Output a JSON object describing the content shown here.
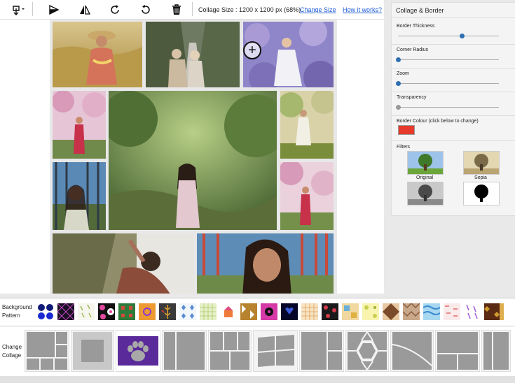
{
  "toolbar": {
    "icons": [
      "download-icon",
      "flip-horizontal-icon",
      "flip-vertical-icon",
      "rotate-right-icon",
      "rotate-left-icon",
      "trash-icon"
    ],
    "collage_size_text": "Collage Size : 1200 x 1200 px (68%)",
    "change_size_label": "Change Size",
    "how_it_works_label": "How it works?"
  },
  "panel": {
    "title": "Collage & Border",
    "sliders": [
      {
        "label": "Border Thickness",
        "value": 0.63
      },
      {
        "label": "Corner Radius",
        "value": 0.0
      },
      {
        "label": "Zoom",
        "value": 0.0
      },
      {
        "label": "Transparency",
        "value": 0.0
      }
    ],
    "border_colour_label": "Border Colour (click below to change)",
    "border_colour": "#e53a2c",
    "filters_label": "Filters",
    "filters": [
      {
        "label": "Original"
      },
      {
        "label": "Sepia"
      },
      {
        "label": ""
      },
      {
        "label": ""
      }
    ]
  },
  "background_pattern": {
    "label": "Background Pattern",
    "pattern_count": 22
  },
  "change_collage": {
    "label": "Change Collage",
    "layout_count": 11
  },
  "colors": {
    "accent_link": "#1a5bd6",
    "slider_knob": "#2d6fb3"
  }
}
